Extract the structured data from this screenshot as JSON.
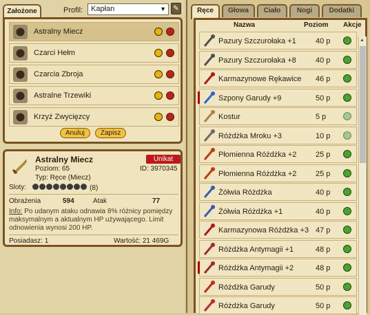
{
  "left": {
    "tab": "Założone",
    "profile_label": "Profil:",
    "profile_value": "Kapłan",
    "equipped": [
      {
        "name": "Astralny Miecz",
        "selected": true,
        "icon": "sword-icon"
      },
      {
        "name": "Czarci Hełm",
        "selected": false,
        "icon": "helmet-icon"
      },
      {
        "name": "Czarcia Zbroja",
        "selected": false,
        "icon": "armor-icon"
      },
      {
        "name": "Astralne Trzewiki",
        "selected": false,
        "icon": "boots-icon"
      },
      {
        "name": "Krzyż Zwycięzcy",
        "selected": false,
        "icon": "cross-icon"
      }
    ],
    "cancel": "Anuluj",
    "save": "Zapisz"
  },
  "detail": {
    "name": "Astralny Miecz",
    "badge": "Unikat",
    "level": "Poziom: 65",
    "id": "ID: 3970345",
    "type": "Typ: Ręce (Miecz)",
    "slots_label": "Sloty:",
    "slots": "(8)",
    "dmg_label": "Obrażenia",
    "dmg": "594",
    "atk_label": "Atak",
    "atk": "77",
    "info_link": "Info:",
    "info": "Po udanym ataku odnawia 8% różnicy pomiędzy maksymalnym a aktualnym HP używającego. Limit odnowienia wynosi 200 HP.",
    "owned": "Posiadasz: 1",
    "value": "Wartość: 21 469G"
  },
  "right": {
    "tabs": [
      "Ręce",
      "Głowa",
      "Ciało",
      "Nogi",
      "Dodatki"
    ],
    "hdr_name": "Nazwa",
    "hdr_level": "Poziom",
    "hdr_actions": "Akcje",
    "items": [
      {
        "name": "Pazury Szczurołaka +1",
        "level": "40 p",
        "color": "#505050",
        "mark": false,
        "dim": false
      },
      {
        "name": "Pazury Szczurołaka +8",
        "level": "40 p",
        "color": "#505050",
        "mark": false,
        "dim": false
      },
      {
        "name": "Karmazynowe Rękawice",
        "level": "46 p",
        "color": "#b01818",
        "mark": false,
        "dim": false
      },
      {
        "name": "Szpony Garudy +9",
        "level": "50 p",
        "color": "#2a6ad0",
        "mark": true,
        "dim": false
      },
      {
        "name": "Kostur",
        "level": "5 p",
        "color": "#b08040",
        "mark": false,
        "dim": true
      },
      {
        "name": "Różdżka Mroku +3",
        "level": "10 p",
        "color": "#6a6a6a",
        "mark": false,
        "dim": true
      },
      {
        "name": "Płomienna Różdżka +2",
        "level": "25 p",
        "color": "#c03a10",
        "mark": false,
        "dim": false
      },
      {
        "name": "Płomienna Różdżka +2",
        "level": "25 p",
        "color": "#c03a10",
        "mark": false,
        "dim": false
      },
      {
        "name": "Żółwia Różdżka",
        "level": "40 p",
        "color": "#3a5ab0",
        "mark": false,
        "dim": false
      },
      {
        "name": "Żółwia Różdżka +1",
        "level": "40 p",
        "color": "#3a5ab0",
        "mark": false,
        "dim": false
      },
      {
        "name": "Karmazynowa Różdżka +3",
        "level": "47 p",
        "color": "#b01818",
        "mark": false,
        "dim": false
      },
      {
        "name": "Różdżka Antymagii +1",
        "level": "48 p",
        "color": "#a02a2a",
        "mark": false,
        "dim": false
      },
      {
        "name": "Różdżka Antymagii +2",
        "level": "48 p",
        "color": "#a02a2a",
        "mark": true,
        "dim": false
      },
      {
        "name": "Różdżka Garudy",
        "level": "50 p",
        "color": "#c02a1a",
        "mark": false,
        "dim": false
      },
      {
        "name": "Różdżka Garudy",
        "level": "50 p",
        "color": "#c02a1a",
        "mark": false,
        "dim": false
      }
    ]
  }
}
